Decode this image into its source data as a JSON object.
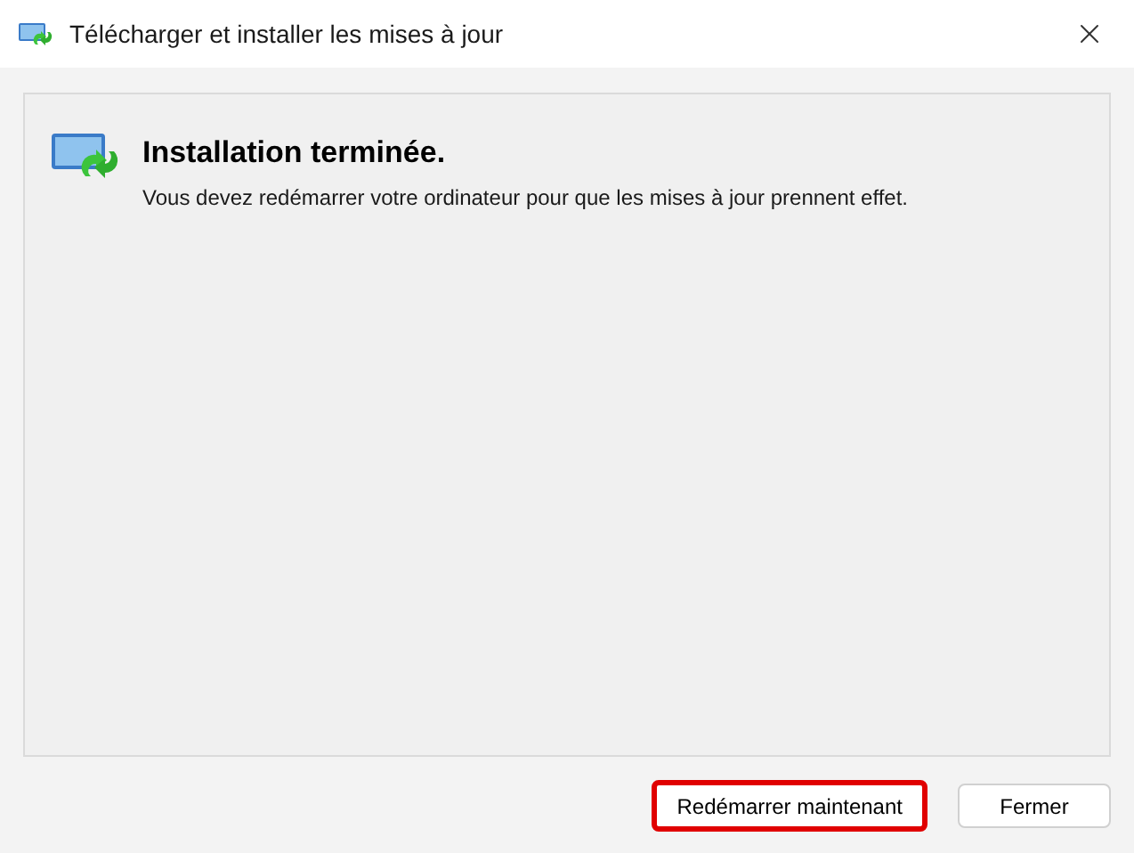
{
  "window": {
    "title": "Télécharger et installer les mises à jour"
  },
  "status": {
    "heading": "Installation terminée.",
    "message": "Vous devez redémarrer votre ordinateur pour que les mises à jour prennent effet."
  },
  "buttons": [
    {
      "label": "Redémarrer maintenant",
      "highlighted": true
    },
    {
      "label": "Fermer",
      "highlighted": false
    }
  ]
}
